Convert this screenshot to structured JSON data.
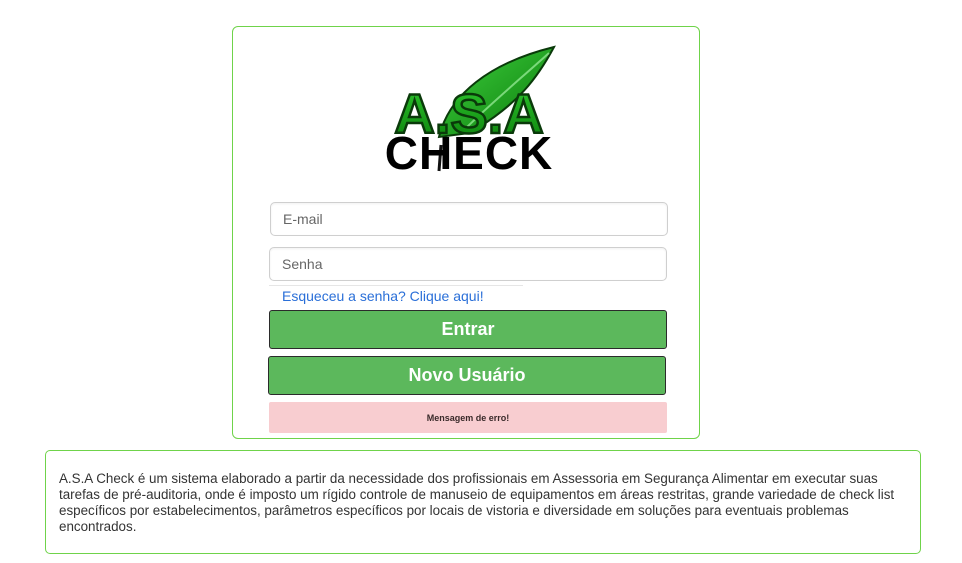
{
  "logo": {
    "line1": "A.S.A",
    "line2": "CHECK"
  },
  "login": {
    "email_placeholder": "E-mail",
    "password_placeholder": "Senha",
    "forgot_password_label": "Esqueceu a senha? Clique aqui!",
    "enter_button_label": "Entrar",
    "new_user_button_label": "Novo Usuário",
    "error_message": "Mensagem de erro!"
  },
  "about": {
    "text": "A.S.A Check é um sistema elaborado a partir da necessidade dos profissionais em Assessoria em Segurança Alimentar em executar suas tarefas de pré-auditoria, onde é imposto um rígido controle de manuseio de equipamentos em áreas restritas, grande variedade de check list específicos por estabelecimentos, parâmetros específicos por locais de vistoria e diversidade em soluções para eventuais problemas encontrados."
  },
  "colors": {
    "border_green": "#6fd34a",
    "button_green": "#5cb85c",
    "link_blue": "#2a6fd8",
    "error_pink": "#f8cdd0",
    "logo_green": "#1a9a1a"
  }
}
